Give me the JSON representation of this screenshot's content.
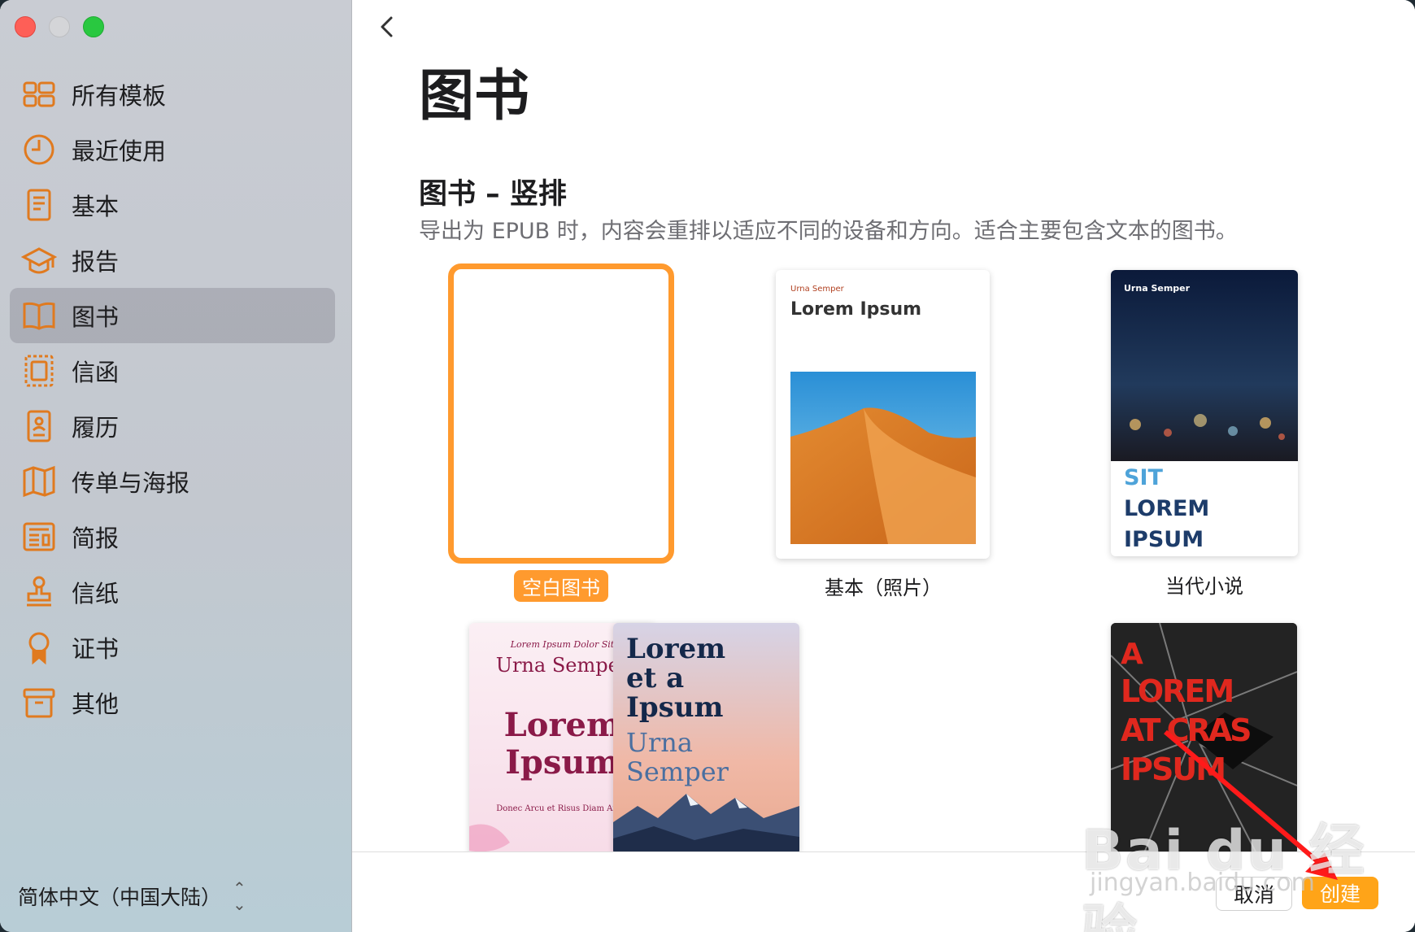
{
  "sidebar": {
    "items": [
      {
        "label": "所有模板",
        "icon": "grid-icon"
      },
      {
        "label": "最近使用",
        "icon": "clock-icon"
      },
      {
        "label": "基本",
        "icon": "document-icon"
      },
      {
        "label": "报告",
        "icon": "graduation-cap-icon"
      },
      {
        "label": "图书",
        "icon": "book-icon",
        "active": true
      },
      {
        "label": "信函",
        "icon": "stamp-frame-icon"
      },
      {
        "label": "履历",
        "icon": "person-document-icon"
      },
      {
        "label": "传单与海报",
        "icon": "map-icon"
      },
      {
        "label": "简报",
        "icon": "newspaper-icon"
      },
      {
        "label": "信纸",
        "icon": "stamp-icon"
      },
      {
        "label": "证书",
        "icon": "ribbon-icon"
      },
      {
        "label": "其他",
        "icon": "archive-box-icon"
      }
    ],
    "language": "简体中文（中国大陆）"
  },
  "main": {
    "title": "图书",
    "section_title": "图书 – 竖排",
    "section_desc": "导出为 EPUB 时，内容会重排以适应不同的设备和方向。适合主要包含文本的图书。",
    "templates": [
      {
        "label": "空白图书",
        "selected": true
      },
      {
        "label": "基本（照片）",
        "small": "Urna Semper",
        "big": "Lorem Ipsum"
      },
      {
        "label": "当代小说",
        "small": "Urna Semper",
        "line1": "SIT",
        "line2": "LOREM",
        "line3": "IPSUM"
      },
      {
        "small": "Lorem Ipsum Dolor Sit",
        "name": "Urna Semper",
        "big1": "Lorem",
        "big2": "Ipsum",
        "sub": "Donec Arcu et Risus Diam Amet"
      },
      {
        "line1": "Lorem",
        "line2": "et a",
        "line3": "Ipsum",
        "line4": "Urna",
        "line5": "Semper"
      },
      {
        "line1": "A",
        "line2": "LOREM",
        "line3": "AT CRAS",
        "line4": "IPSUM"
      }
    ]
  },
  "footer": {
    "cancel": "取消",
    "create": "创建"
  },
  "watermark": {
    "text": "Bai du 经验",
    "url": "jingyan.baidu.com"
  },
  "colors": {
    "accent": "#ff9a2e",
    "create_button": "#ffa418"
  }
}
